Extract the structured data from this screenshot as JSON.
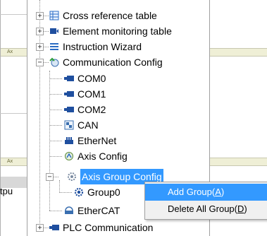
{
  "tree": {
    "items": [
      {
        "label": "Cross reference table",
        "icon": "table-icon"
      },
      {
        "label": "Element monitoring table",
        "icon": "monitor-icon"
      },
      {
        "label": "Instruction Wizard",
        "icon": "list-icon"
      },
      {
        "label": "Communication Config",
        "icon": "network-icon"
      },
      {
        "label": "COM0",
        "icon": "port-icon"
      },
      {
        "label": "COM1",
        "icon": "port-icon"
      },
      {
        "label": "COM2",
        "icon": "port-icon"
      },
      {
        "label": "CAN",
        "icon": "can-icon"
      },
      {
        "label": "EtherNet",
        "icon": "ethernet-icon"
      },
      {
        "label": "Axis Config",
        "icon": "axis-icon"
      },
      {
        "label": "Axis Group Config",
        "icon": "axis-group-icon"
      },
      {
        "label": "Group0",
        "icon": "gear-icon"
      },
      {
        "label": "EtherCAT",
        "icon": "ethercat-icon"
      },
      {
        "label": "PLC Communication",
        "icon": "port-icon"
      }
    ]
  },
  "left_panel": {
    "cut_text": "tpu"
  },
  "context_menu": {
    "items": [
      {
        "label": "Add Group(A)"
      },
      {
        "label": "Delete All Group(D)"
      }
    ]
  },
  "colors": {
    "selection": "#3399ff",
    "tree_lines": "#909090",
    "menu_bg": "#f0f0f0"
  }
}
